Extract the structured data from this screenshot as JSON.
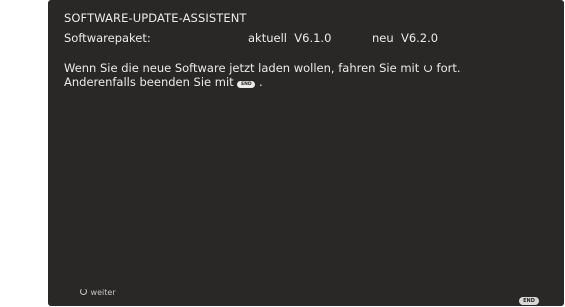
{
  "dialog": {
    "title": "SOFTWARE-UPDATE-ASSISTENT",
    "package_label": "Softwarepaket:",
    "current_version": "aktuell  V6.1.0",
    "new_version": "neu  V6.2.0",
    "message_line1_before_icon": "Wenn Sie die neue Software jetzt laden wollen, fahren Sie mit ",
    "message_line1_after_icon": " fort.",
    "message_line2_before_icon": "Anderenfalls beenden Sie mit ",
    "message_line2_after_icon": " .",
    "ok_icon": "ok-circle-icon",
    "end_icon_label": "END"
  },
  "footer": {
    "continue_icon": "ok-circle-icon",
    "continue_label": "weiter",
    "end_button_label": "END"
  }
}
